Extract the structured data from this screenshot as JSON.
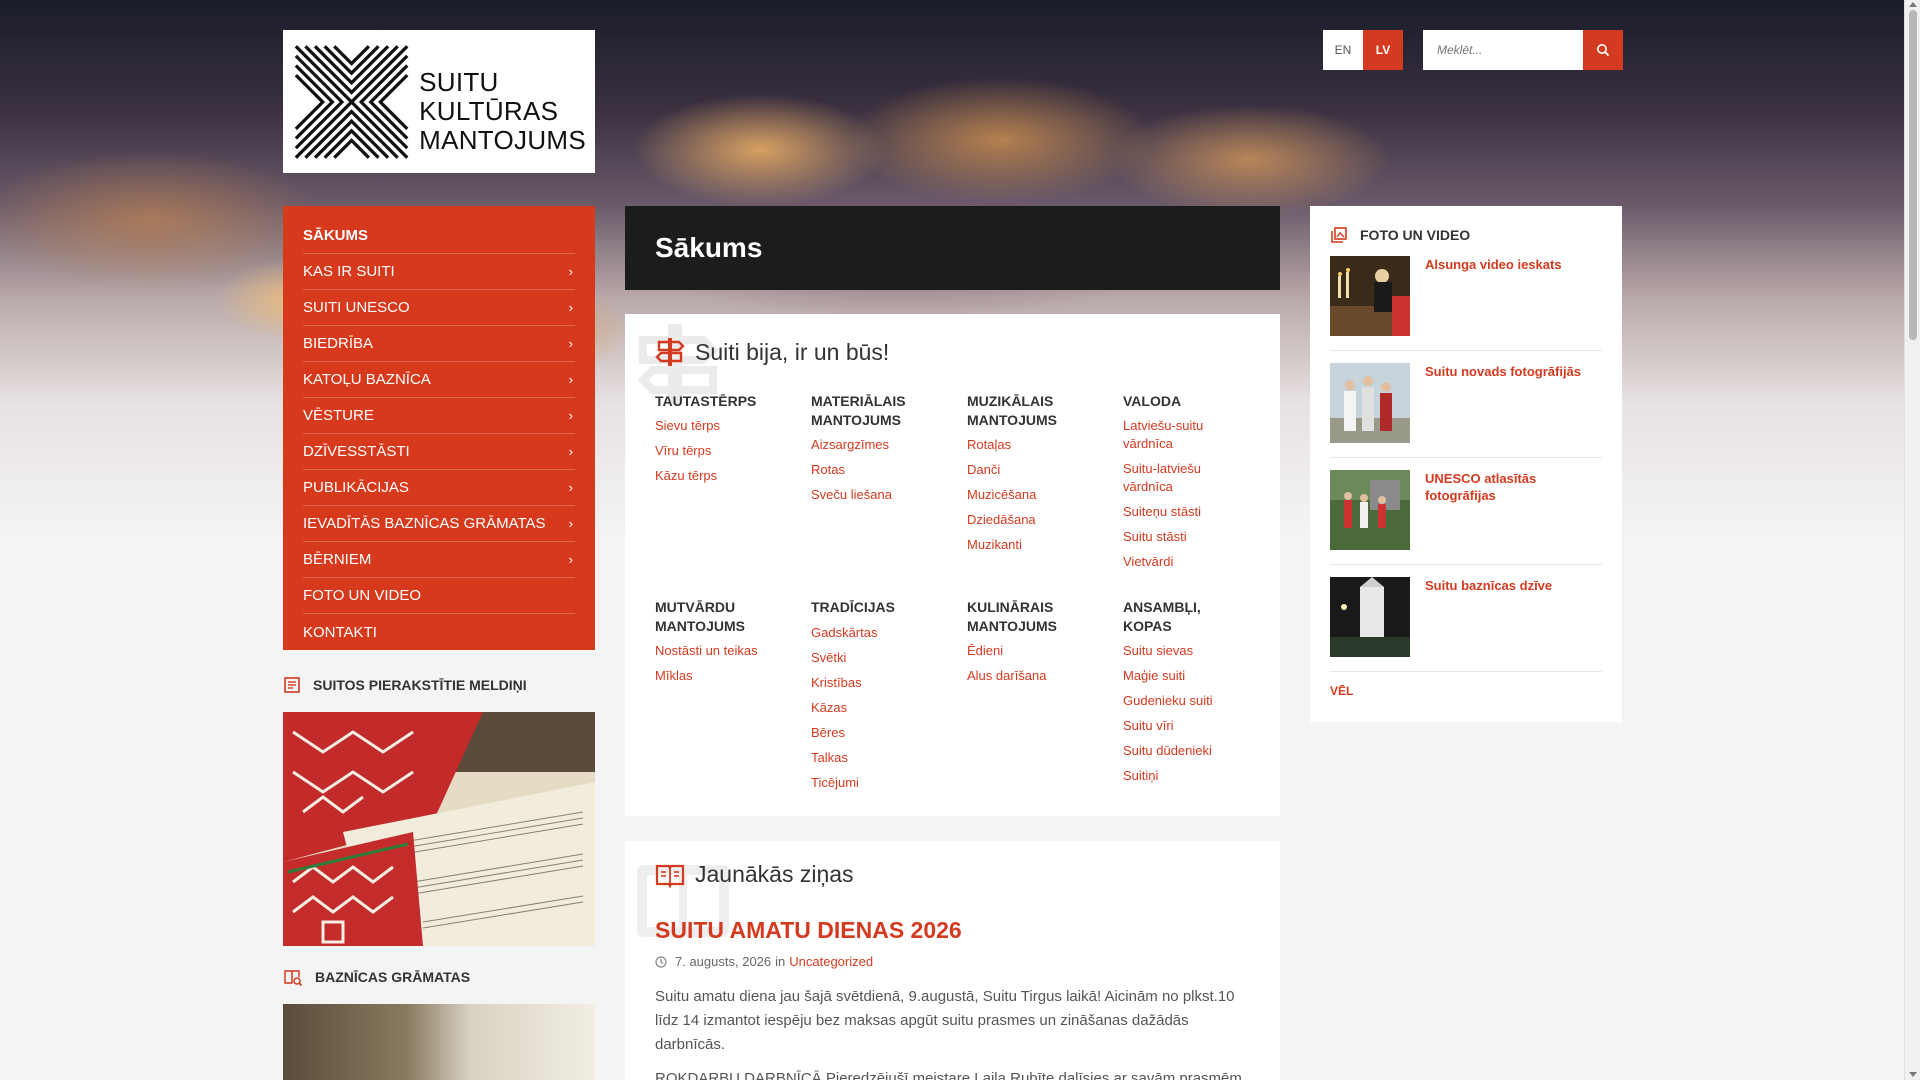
{
  "brand": {
    "logo_lines": [
      "SUITU",
      "KULTŪRAS",
      "MANTOJUMS"
    ],
    "accent_color": "#d43a1f"
  },
  "header": {
    "lang_en": "EN",
    "lang_lv": "LV",
    "search_placeholder": "Meklēt..."
  },
  "menu": {
    "items": [
      {
        "label": "SĀKUMS",
        "has_arrow": false
      },
      {
        "label": "KAS IR SUITI",
        "has_arrow": true
      },
      {
        "label": "SUITI UNESCO",
        "has_arrow": true
      },
      {
        "label": "BIEDRĪBA",
        "has_arrow": true
      },
      {
        "label": "KATOĻU BAZNĪCA",
        "has_arrow": true
      },
      {
        "label": "VĒSTURE",
        "has_arrow": true
      },
      {
        "label": "DZĪVESSTĀSTI",
        "has_arrow": true
      },
      {
        "label": "PUBLIKĀCIJAS",
        "has_arrow": true
      },
      {
        "label": "IEVADĪTĀS BAZNĪCAS GRĀMATAS",
        "has_arrow": true
      },
      {
        "label": "BĒRNIEM",
        "has_arrow": true
      },
      {
        "label": "FOTO UN VIDEO",
        "has_arrow": false
      },
      {
        "label": "KONTAKTI",
        "has_arrow": false
      }
    ]
  },
  "sidebar": {
    "melodies_title": "SUITOS PIERAKSTĪTIE MELDIŅI",
    "books_title": "BAZNĪCAS GRĀMATAS"
  },
  "main": {
    "page_title": "Sākums",
    "section_heading": "Suiti bija, ir un būs!",
    "columns": [
      {
        "title": "TAUTASTĒRPS",
        "links": [
          "Sievu tērps",
          "Vīru tērps",
          "Kāzu tērps"
        ]
      },
      {
        "title": "MATERIĀLAIS MANTOJUMS",
        "links": [
          "Aizsargzīmes",
          "Rotas",
          "Sveču liešana"
        ]
      },
      {
        "title": "MUZIKĀLAIS MANTOJUMS",
        "links": [
          "Rotaļas",
          "Danči",
          "Muzicēšana",
          "Dziedāšana",
          "Muzikanti"
        ]
      },
      {
        "title": "VALODA",
        "links": [
          "Latviešu-suitu vārdnīca",
          "Suitu-latviešu vārdnīca",
          "Suiteņu stāsti",
          "Suitu stāsti",
          "Vietvārdi"
        ]
      },
      {
        "title": "MUTVĀRDU MANTOJUMS",
        "links": [
          "Nostāsti un teikas",
          "Mīklas"
        ]
      },
      {
        "title": "TRADĪCIJAS",
        "links": [
          "Gadskārtas",
          "Svētki",
          "Kristības",
          "Kāzas",
          "Bēres",
          "Talkas",
          "Ticējumi"
        ]
      },
      {
        "title": "KULINĀRAIS MANTOJUMS",
        "links": [
          "Ēdieni",
          "Alus darīšana"
        ]
      },
      {
        "title": "ANSAMBĻI, KOPAS",
        "links": [
          "Suitu sievas",
          "Maģie suiti",
          "Gudenieku suiti",
          "Suitu vīri",
          "Suitu dūdenieki",
          "Suitiņi"
        ]
      }
    ],
    "news_heading": "Jaunākās ziņas",
    "news": {
      "title": "SUITU AMATU DIENAS 2026",
      "date": "7. augusts, 2026",
      "in_word": "in",
      "category": "Uncategorized",
      "body": "Suitu amatu diena jau šajā svētdienā, 9.augustā, Suitu Tirgus laikā! Aicinām no plkst.10 līdz 14 izmantot iespēju bez maksas apgūt suitu prasmes un zināšanas dažādās darbnīcās.",
      "body2": "ROKDARBU DARBNĪCĀ Pieredzējušī meistare Laila Rubīte dalīsies ar savām prasmēm"
    }
  },
  "right": {
    "title": "FOTO UN VIDEO",
    "items": [
      {
        "label": "Alsunga video ieskats"
      },
      {
        "label": "Suitu novads fotogrāfijās"
      },
      {
        "label": "UNESCO atlasītās fotogrāfijas"
      },
      {
        "label": "Suitu baznīcas dzīve"
      }
    ],
    "more": "VĒL"
  }
}
